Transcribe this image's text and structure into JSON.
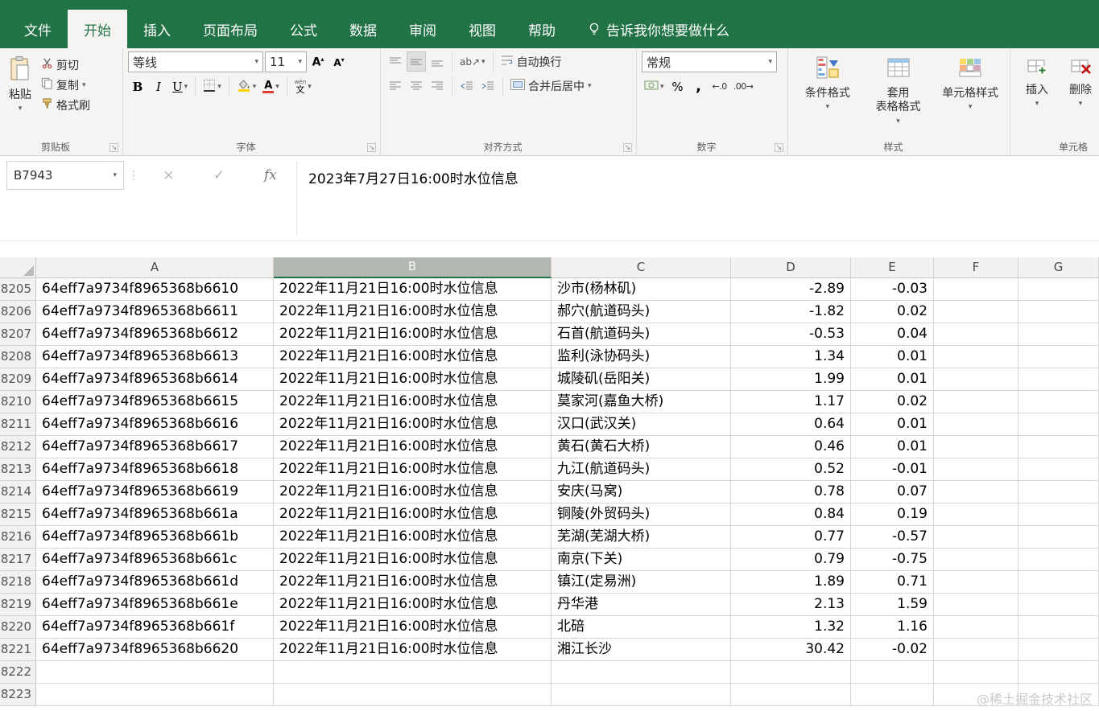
{
  "colors": {
    "excel_green": "#217346",
    "fill_yellow": "#ffd400",
    "font_red": "#e03c32",
    "delete_red": "#c00000"
  },
  "icons": {
    "dropdown": "▾",
    "dialog_launcher": "↘",
    "name_box_dropdown": "▾",
    "increase_decimal": "←.0",
    "decrease_decimal": ".00→",
    "orientation": "ab↗"
  },
  "ribbon": {
    "tabs": [
      {
        "id": "file",
        "label": "文件"
      },
      {
        "id": "home",
        "label": "开始",
        "active": true
      },
      {
        "id": "insert",
        "label": "插入"
      },
      {
        "id": "page-layout",
        "label": "页面布局"
      },
      {
        "id": "formulas",
        "label": "公式"
      },
      {
        "id": "data",
        "label": "数据"
      },
      {
        "id": "review",
        "label": "审阅"
      },
      {
        "id": "view",
        "label": "视图"
      },
      {
        "id": "help",
        "label": "帮助"
      },
      {
        "id": "tellme",
        "label": "告诉我你想要做什么",
        "tellme": true
      }
    ],
    "clipboard": {
      "group_label": "剪贴板",
      "paste": "粘贴",
      "cut": "剪切",
      "copy": "复制",
      "format_painter": "格式刷"
    },
    "font": {
      "group_label": "字体",
      "font_name": "等线",
      "font_size": "11",
      "phonetic_small": "wén",
      "phonetic_char": "文"
    },
    "alignment": {
      "group_label": "对齐方式",
      "wrap_text": "自动换行",
      "merge_center": "合并后居中"
    },
    "number": {
      "group_label": "数字",
      "format": "常规",
      "percent": "%",
      "comma": ","
    },
    "styles": {
      "group_label": "样式",
      "conditional_formatting": "条件格式",
      "format_as_table_1": "套用",
      "format_as_table_2": "表格格式",
      "cell_styles": "单元格样式"
    },
    "cells": {
      "group_label": "单元格",
      "insert": "插入",
      "delete": "删除"
    }
  },
  "formula_bar": {
    "name_box": "B7943",
    "cancel": "×",
    "enter": "✓",
    "fx": "fx",
    "content": "2023年7月27日16:00时水位信息"
  },
  "grid": {
    "columns": [
      "A",
      "B",
      "C",
      "D",
      "E",
      "F",
      "G"
    ],
    "selected_column": "B",
    "rows": [
      [
        "8205",
        "64eff7a9734f8965368b6610",
        "2022年11月21日16:00时水位信息",
        "沙市(杨林矶)",
        "-2.89",
        "-0.03"
      ],
      [
        "8206",
        "64eff7a9734f8965368b6611",
        "2022年11月21日16:00时水位信息",
        "郝穴(航道码头)",
        "-1.82",
        "0.02"
      ],
      [
        "8207",
        "64eff7a9734f8965368b6612",
        "2022年11月21日16:00时水位信息",
        "石首(航道码头)",
        "-0.53",
        "0.04"
      ],
      [
        "8208",
        "64eff7a9734f8965368b6613",
        "2022年11月21日16:00时水位信息",
        "监利(泳协码头)",
        "1.34",
        "0.01"
      ],
      [
        "8209",
        "64eff7a9734f8965368b6614",
        "2022年11月21日16:00时水位信息",
        "城陵矶(岳阳关)",
        "1.99",
        "0.01"
      ],
      [
        "8210",
        "64eff7a9734f8965368b6615",
        "2022年11月21日16:00时水位信息",
        "莫家河(嘉鱼大桥)",
        "1.17",
        "0.02"
      ],
      [
        "8211",
        "64eff7a9734f8965368b6616",
        "2022年11月21日16:00时水位信息",
        "汉口(武汉关)",
        "0.64",
        "0.01"
      ],
      [
        "8212",
        "64eff7a9734f8965368b6617",
        "2022年11月21日16:00时水位信息",
        "黄石(黄石大桥)",
        "0.46",
        "0.01"
      ],
      [
        "8213",
        "64eff7a9734f8965368b6618",
        "2022年11月21日16:00时水位信息",
        "九江(航道码头)",
        "0.52",
        "-0.01"
      ],
      [
        "8214",
        "64eff7a9734f8965368b6619",
        "2022年11月21日16:00时水位信息",
        "安庆(马窝)",
        "0.78",
        "0.07"
      ],
      [
        "8215",
        "64eff7a9734f8965368b661a",
        "2022年11月21日16:00时水位信息",
        "铜陵(外贸码头)",
        "0.84",
        "0.19"
      ],
      [
        "8216",
        "64eff7a9734f8965368b661b",
        "2022年11月21日16:00时水位信息",
        "芜湖(芜湖大桥)",
        "0.77",
        "-0.57"
      ],
      [
        "8217",
        "64eff7a9734f8965368b661c",
        "2022年11月21日16:00时水位信息",
        "南京(下关)",
        "0.79",
        "-0.75"
      ],
      [
        "8218",
        "64eff7a9734f8965368b661d",
        "2022年11月21日16:00时水位信息",
        "镇江(定易洲)",
        "1.89",
        "0.71"
      ],
      [
        "8219",
        "64eff7a9734f8965368b661e",
        "2022年11月21日16:00时水位信息",
        "丹华港",
        "2.13",
        "1.59"
      ],
      [
        "8220",
        "64eff7a9734f8965368b661f",
        "2022年11月21日16:00时水位信息",
        "北碚",
        "1.32",
        "1.16"
      ],
      [
        "8221",
        "64eff7a9734f8965368b6620",
        "2022年11月21日16:00时水位信息",
        "湘江长沙",
        "30.42",
        "-0.02"
      ],
      [
        "8222",
        "",
        "",
        "",
        "",
        ""
      ],
      [
        "8223",
        "",
        "",
        "",
        "",
        ""
      ]
    ]
  },
  "watermark": "@稀土掘金技术社区"
}
